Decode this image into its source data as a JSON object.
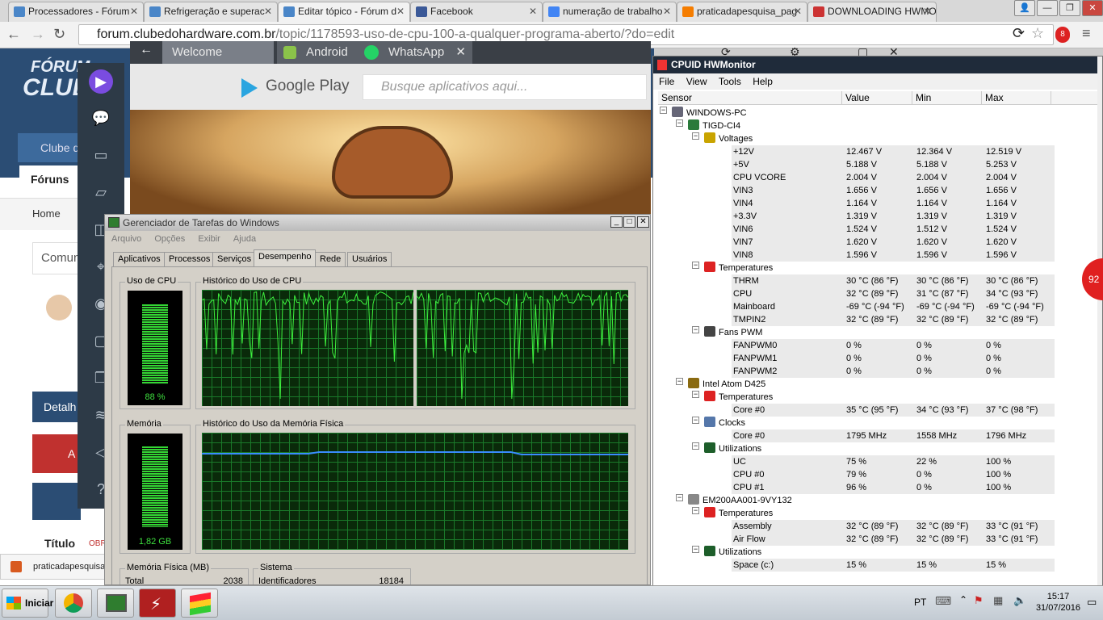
{
  "browser": {
    "tabs": [
      {
        "label": "Processadores - Fórum",
        "color": "#4a86c8"
      },
      {
        "label": "Refrigeração e superac",
        "color": "#4a86c8"
      },
      {
        "label": "Editar tópico - Fórum d",
        "color": "#4a86c8"
      },
      {
        "label": "Facebook",
        "color": "#3b5998"
      },
      {
        "label": "numeração de trabalho",
        "color": "#4285f4"
      },
      {
        "label": "praticadapesquisa_pag",
        "color": "#f57d00"
      },
      {
        "label": "DOWNLOADING HWMO",
        "color": "#cc3333"
      }
    ],
    "url_host": "forum.clubedohardware.com.br",
    "url_path": "/topic/1178593-uso-de-cpu-100-a-qualquer-programa-aberto/?do=edit",
    "ext_badge": "8"
  },
  "forum": {
    "logo_line1": "FÓRUM",
    "logo_line2": "CLUB",
    "nav_club": "Clube d",
    "nav_forums": "Fóruns",
    "breadcrumb_home": "Home",
    "comm": "Comun",
    "detail": "Detalh",
    "alert": "A",
    "field_title": "Título",
    "required": "OBR",
    "download_item": "praticadapesquisa"
  },
  "android": {
    "tabs": [
      "Welcome",
      "Android",
      "WhatsApp"
    ],
    "store": "Google Play",
    "search_placeholder": "Busque aplicativos aqui..."
  },
  "taskmgr": {
    "title": "Gerenciador de Tarefas do Windows",
    "menu": [
      "Arquivo",
      "Opções",
      "Exibir",
      "Ajuda"
    ],
    "tabs": [
      "Aplicativos",
      "Processos",
      "Serviços",
      "Desempenho",
      "Rede",
      "Usuários"
    ],
    "cpu_label": "Uso de CPU",
    "cpu_history": "Histórico do Uso de CPU",
    "cpu_value": "88 %",
    "mem_label": "Memória",
    "mem_history": "Histórico do Uso da Memória Física",
    "mem_value": "1,82 GB",
    "phys_mem": "Memória Física (MB)",
    "total_label": "Total",
    "total_value": "2038",
    "system": "Sistema",
    "ident_label": "Identificadores",
    "ident_value": "18184",
    "cpu_pct": 0.88,
    "mem_pct": 0.89
  },
  "hwmon": {
    "title": "CPUID HWMonitor",
    "menu": [
      "File",
      "View",
      "Tools",
      "Help"
    ],
    "columns": [
      "Sensor",
      "Value",
      "Min",
      "Max"
    ],
    "rows": [
      {
        "lvl": 0,
        "name": "WINDOWS-PC",
        "icon": "computer-icon",
        "tree": "-"
      },
      {
        "lvl": 1,
        "name": "TIGD-CI4",
        "icon": "motherboard-icon",
        "tree": "-"
      },
      {
        "lvl": 2,
        "name": "Voltages",
        "icon": "voltage-icon",
        "tree": "-"
      },
      {
        "lvl": 3,
        "name": "+12V",
        "v": "12.467 V",
        "mn": "12.364 V",
        "mx": "12.519 V"
      },
      {
        "lvl": 3,
        "name": "+5V",
        "v": "5.188 V",
        "mn": "5.188 V",
        "mx": "5.253 V"
      },
      {
        "lvl": 3,
        "name": "CPU VCORE",
        "v": "2.004 V",
        "mn": "2.004 V",
        "mx": "2.004 V"
      },
      {
        "lvl": 3,
        "name": "VIN3",
        "v": "1.656 V",
        "mn": "1.656 V",
        "mx": "1.656 V"
      },
      {
        "lvl": 3,
        "name": "VIN4",
        "v": "1.164 V",
        "mn": "1.164 V",
        "mx": "1.164 V"
      },
      {
        "lvl": 3,
        "name": "+3.3V",
        "v": "1.319 V",
        "mn": "1.319 V",
        "mx": "1.319 V"
      },
      {
        "lvl": 3,
        "name": "VIN6",
        "v": "1.524 V",
        "mn": "1.512 V",
        "mx": "1.524 V"
      },
      {
        "lvl": 3,
        "name": "VIN7",
        "v": "1.620 V",
        "mn": "1.620 V",
        "mx": "1.620 V"
      },
      {
        "lvl": 3,
        "name": "VIN8",
        "v": "1.596 V",
        "mn": "1.596 V",
        "mx": "1.596 V"
      },
      {
        "lvl": 2,
        "name": "Temperatures",
        "icon": "thermometer-icon",
        "tree": "-"
      },
      {
        "lvl": 3,
        "name": "THRM",
        "v": "30 °C  (86 °F)",
        "mn": "30 °C  (86 °F)",
        "mx": "30 °C  (86 °F)"
      },
      {
        "lvl": 3,
        "name": "CPU",
        "v": "32 °C  (89 °F)",
        "mn": "31 °C  (87 °F)",
        "mx": "34 °C  (93 °F)"
      },
      {
        "lvl": 3,
        "name": "Mainboard",
        "v": "-69 °C  (-94 °F)",
        "mn": "-69 °C  (-94 °F)",
        "mx": "-69 °C  (-94 °F)"
      },
      {
        "lvl": 3,
        "name": "TMPIN2",
        "v": "32 °C  (89 °F)",
        "mn": "32 °C  (89 °F)",
        "mx": "32 °C  (89 °F)"
      },
      {
        "lvl": 2,
        "name": "Fans PWM",
        "icon": "fan-icon",
        "tree": "-"
      },
      {
        "lvl": 3,
        "name": "FANPWM0",
        "v": "0 %",
        "mn": "0 %",
        "mx": "0 %"
      },
      {
        "lvl": 3,
        "name": "FANPWM1",
        "v": "0 %",
        "mn": "0 %",
        "mx": "0 %"
      },
      {
        "lvl": 3,
        "name": "FANPWM2",
        "v": "0 %",
        "mn": "0 %",
        "mx": "0 %"
      },
      {
        "lvl": 1,
        "name": "Intel Atom D425",
        "icon": "cpu-icon",
        "tree": "-"
      },
      {
        "lvl": 2,
        "name": "Temperatures",
        "icon": "thermometer-icon",
        "tree": "-"
      },
      {
        "lvl": 3,
        "name": "Core #0",
        "v": "35 °C  (95 °F)",
        "mn": "34 °C  (93 °F)",
        "mx": "37 °C  (98 °F)"
      },
      {
        "lvl": 2,
        "name": "Clocks",
        "icon": "clock-icon",
        "tree": "-"
      },
      {
        "lvl": 3,
        "name": "Core #0",
        "v": "1795 MHz",
        "mn": "1558 MHz",
        "mx": "1796 MHz"
      },
      {
        "lvl": 2,
        "name": "Utilizations",
        "icon": "utilization-icon",
        "tree": "-"
      },
      {
        "lvl": 3,
        "name": "UC",
        "v": "75 %",
        "mn": "22 %",
        "mx": "100 %"
      },
      {
        "lvl": 3,
        "name": "CPU #0",
        "v": "79 %",
        "mn": "0 %",
        "mx": "100 %"
      },
      {
        "lvl": 3,
        "name": "CPU #1",
        "v": "96 %",
        "mn": "0 %",
        "mx": "100 %"
      },
      {
        "lvl": 1,
        "name": "EM200AA001-9VY132",
        "icon": "disk-icon",
        "tree": "-"
      },
      {
        "lvl": 2,
        "name": "Temperatures",
        "icon": "thermometer-icon",
        "tree": "-"
      },
      {
        "lvl": 3,
        "name": "Assembly",
        "v": "32 °C  (89 °F)",
        "mn": "32 °C  (89 °F)",
        "mx": "33 °C  (91 °F)"
      },
      {
        "lvl": 3,
        "name": "Air Flow",
        "v": "32 °C  (89 °F)",
        "mn": "32 °C  (89 °F)",
        "mx": "33 °C  (91 °F)"
      },
      {
        "lvl": 2,
        "name": "Utilizations",
        "icon": "utilization-icon",
        "tree": "-"
      },
      {
        "lvl": 3,
        "name": "Space (c:)",
        "v": "15 %",
        "mn": "15 %",
        "mx": "15 %"
      }
    ]
  },
  "notification_badge": "92",
  "taskbar": {
    "start": "Iniciar",
    "lang": "PT",
    "time": "15:17",
    "date": "31/07/2016"
  }
}
